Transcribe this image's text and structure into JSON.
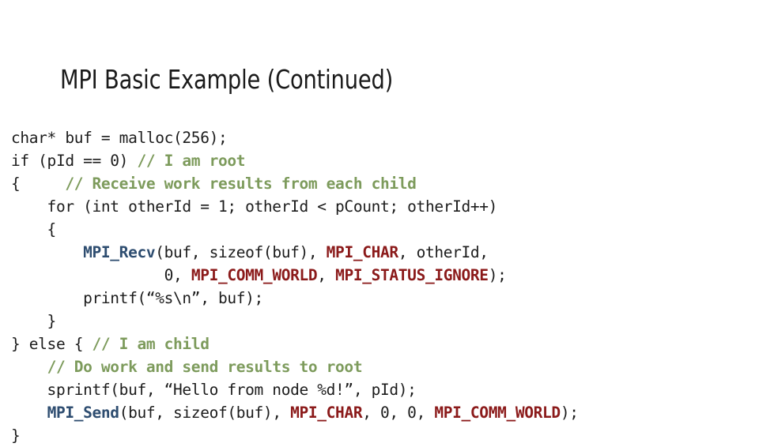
{
  "slide": {
    "title": "MPI Basic Example (Continued)",
    "background_color": "#ffffff"
  },
  "colors": {
    "plain": "#1c1c1c",
    "comment": "#7d9b5c",
    "function": "#2e4d70",
    "constant": "#8b1a1a",
    "title": "#1a1a1a"
  },
  "code": {
    "language": "c",
    "lines": [
      {
        "index": 0,
        "indent": 0,
        "text": "char* buf = malloc(256);",
        "tokens": [
          {
            "t": "char* buf = malloc(256);",
            "k": "plain"
          }
        ]
      },
      {
        "index": 1,
        "indent": 0,
        "text": "if (pId == 0) // I am root",
        "tokens": [
          {
            "t": "if (pId == 0) ",
            "k": "plain"
          },
          {
            "t": "// I am root",
            "k": "comment"
          }
        ]
      },
      {
        "index": 2,
        "indent": 0,
        "text": "{     // Receive work results from each child",
        "tokens": [
          {
            "t": "{     ",
            "k": "plain"
          },
          {
            "t": "// Receive work results from each child",
            "k": "comment"
          }
        ]
      },
      {
        "index": 3,
        "indent": 4,
        "text": "    for (int otherId = 1; otherId < pCount; otherId++)",
        "tokens": [
          {
            "t": "    for (int otherId = 1; otherId < pCount; otherId++)",
            "k": "plain"
          }
        ]
      },
      {
        "index": 4,
        "indent": 4,
        "text": "    {",
        "tokens": [
          {
            "t": "    {",
            "k": "plain"
          }
        ]
      },
      {
        "index": 5,
        "indent": 12,
        "text": "        MPI_Recv(buf, sizeof(buf), MPI_CHAR, otherId,",
        "tokens": [
          {
            "t": "        ",
            "k": "plain"
          },
          {
            "t": "MPI_Recv",
            "k": "function"
          },
          {
            "t": "(buf, sizeof(buf), ",
            "k": "plain"
          },
          {
            "t": "MPI_CHAR",
            "k": "constant"
          },
          {
            "t": ", otherId,",
            "k": "plain"
          }
        ]
      },
      {
        "index": 6,
        "indent": 18,
        "text": "                 0, MPI_COMM_WORLD, MPI_STATUS_IGNORE);",
        "tokens": [
          {
            "t": "                 0, ",
            "k": "plain"
          },
          {
            "t": "MPI_COMM_WORLD",
            "k": "constant"
          },
          {
            "t": ", ",
            "k": "plain"
          },
          {
            "t": "MPI_STATUS_IGNORE",
            "k": "constant"
          },
          {
            "t": ");",
            "k": "plain"
          }
        ]
      },
      {
        "index": 7,
        "indent": 12,
        "text": "        printf(“%s\\n”, buf);",
        "tokens": [
          {
            "t": "        printf(“%s\\n”, buf);",
            "k": "plain"
          }
        ]
      },
      {
        "index": 8,
        "indent": 4,
        "text": "    }",
        "tokens": [
          {
            "t": "    }",
            "k": "plain"
          }
        ]
      },
      {
        "index": 9,
        "indent": 0,
        "text": "} else { // I am child",
        "tokens": [
          {
            "t": "} else { ",
            "k": "plain"
          },
          {
            "t": "// I am child",
            "k": "comment"
          }
        ]
      },
      {
        "index": 10,
        "indent": 4,
        "text": "    // Do work and send results to root",
        "tokens": [
          {
            "t": "    ",
            "k": "plain"
          },
          {
            "t": "// Do work and send results to root",
            "k": "comment"
          }
        ]
      },
      {
        "index": 11,
        "indent": 4,
        "text": "    sprintf(buf, “Hello from node %d!”, pId);",
        "tokens": [
          {
            "t": "    sprintf(buf, “Hello from node %d!”, pId);",
            "k": "plain"
          }
        ]
      },
      {
        "index": 12,
        "indent": 4,
        "text": "    MPI_Send(buf, sizeof(buf), MPI_CHAR, 0, 0, MPI_COMM_WORLD);",
        "tokens": [
          {
            "t": "    ",
            "k": "plain"
          },
          {
            "t": "MPI_Send",
            "k": "function"
          },
          {
            "t": "(buf, sizeof(buf), ",
            "k": "plain"
          },
          {
            "t": "MPI_CHAR",
            "k": "constant"
          },
          {
            "t": ", 0, 0, ",
            "k": "plain"
          },
          {
            "t": "MPI_COMM_WORLD",
            "k": "constant"
          },
          {
            "t": ");",
            "k": "plain"
          }
        ]
      },
      {
        "index": 13,
        "indent": 0,
        "text": "}",
        "tokens": [
          {
            "t": "}",
            "k": "plain"
          }
        ]
      }
    ]
  }
}
